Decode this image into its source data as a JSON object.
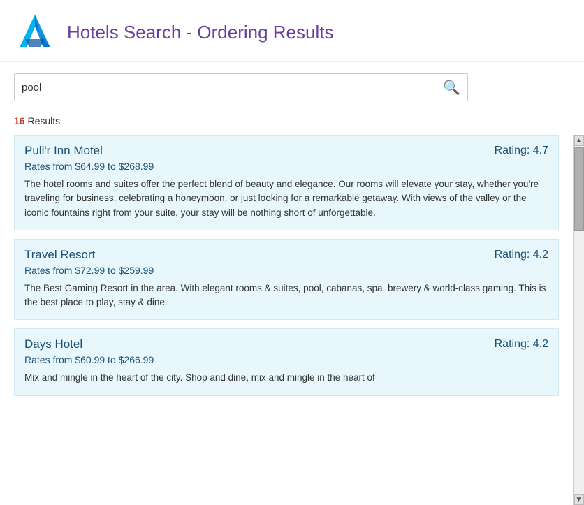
{
  "header": {
    "title": "Hotels Search - Ordering Results"
  },
  "search": {
    "placeholder": "pool",
    "value": "pool",
    "icon": "🔍"
  },
  "results": {
    "count_label": "16 Results",
    "count": "16",
    "text": "Results"
  },
  "hotels": [
    {
      "name": "Pull'r Inn Motel",
      "rating_label": "Rating: 4.7",
      "rates": "Rates from $64.99 to $268.99",
      "description": "The hotel rooms and suites offer the perfect blend of beauty and elegance. Our rooms will elevate your stay, whether you're traveling for business, celebrating a honeymoon, or just looking for a remarkable getaway. With views of the valley or the iconic fountains right from your suite, your stay will be nothing short of unforgettable."
    },
    {
      "name": "Travel Resort",
      "rating_label": "Rating: 4.2",
      "rates": "Rates from $72.99 to $259.99",
      "description": "The Best Gaming Resort in the area.  With elegant rooms & suites, pool, cabanas, spa, brewery & world-class gaming.  This is the best place to play, stay & dine."
    },
    {
      "name": "Days Hotel",
      "rating_label": "Rating: 4.2",
      "rates": "Rates from $60.99 to $266.99",
      "description": "Mix and mingle in the heart of the city.  Shop and dine, mix and mingle in the heart of"
    }
  ]
}
